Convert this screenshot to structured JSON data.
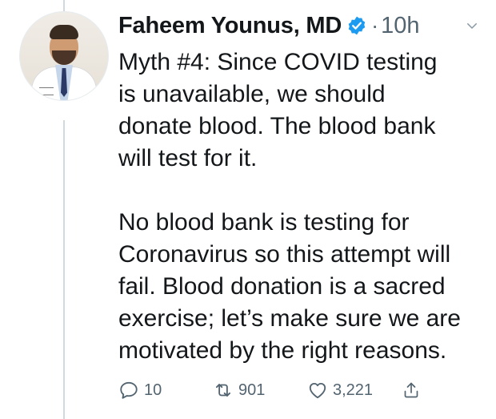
{
  "tweet": {
    "author_name": "Faheem Younus, MD",
    "separator": "·",
    "time": "10h",
    "text": "Myth #4: Since COVID testing\nis unavailable, we should\ndonate blood. The blood bank\nwill test for it.\n\nNo blood bank is testing for\nCoronavirus so this attempt will\nfail. Blood donation is a sacred\nexercise; let’s make sure we are\nmotivated by the right reasons."
  },
  "actions": {
    "replies": "10",
    "retweets": "901",
    "likes": "3,221"
  },
  "icons": {
    "verified": "verified-badge-icon",
    "menu": "chevron-down-icon",
    "reply": "reply-icon",
    "retweet": "retweet-icon",
    "like": "heart-icon",
    "share": "share-icon"
  },
  "colors": {
    "text": "#14171a",
    "muted": "#536471",
    "verified": "#1d9bf0",
    "thread_line": "#cfd9de"
  }
}
